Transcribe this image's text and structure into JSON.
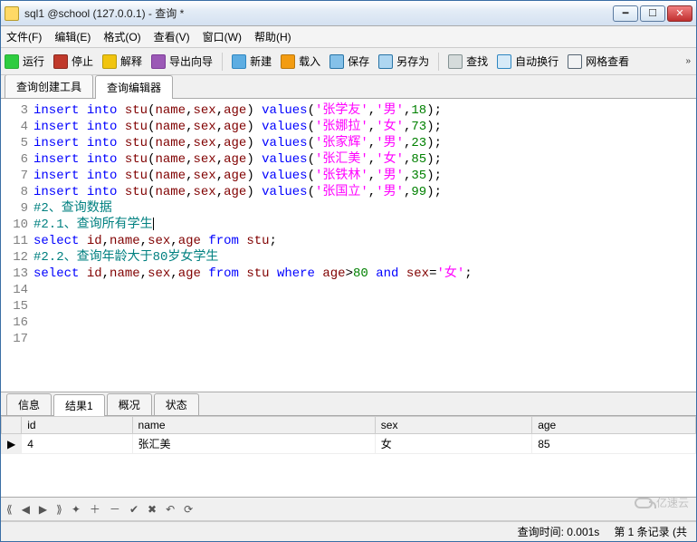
{
  "window": {
    "title": "sql1 @school (127.0.0.1) - 查询 *"
  },
  "menus": [
    "文件(F)",
    "编辑(E)",
    "格式(O)",
    "查看(V)",
    "窗口(W)",
    "帮助(H)"
  ],
  "toolbar": {
    "run": "运行",
    "stop": "停止",
    "explain": "解释",
    "export": "导出向导",
    "new": "新建",
    "load": "载入",
    "save": "保存",
    "saveas": "另存为",
    "find": "查找",
    "wrap": "自动换行",
    "grid": "网格查看"
  },
  "editor_tabs": {
    "builder": "查询创建工具",
    "editor": "查询编辑器"
  },
  "code": {
    "line_start": 3,
    "lines": [
      {
        "n": 3,
        "raw": "insert into stu(name,sex,age) values('张学友','男',18);"
      },
      {
        "n": 4,
        "raw": "insert into stu(name,sex,age) values('张娜拉','女',73);"
      },
      {
        "n": 5,
        "raw": "insert into stu(name,sex,age) values('张家辉','男',23);"
      },
      {
        "n": 6,
        "raw": "insert into stu(name,sex,age) values('张汇美','女',85);"
      },
      {
        "n": 7,
        "raw": "insert into stu(name,sex,age) values('张铁林','男',35);"
      },
      {
        "n": 8,
        "raw": ""
      },
      {
        "n": 9,
        "raw": "insert into stu(name,sex,age) values('张国立','男',99);"
      },
      {
        "n": 10,
        "raw": ""
      },
      {
        "n": 11,
        "raw": "#2、查询数据"
      },
      {
        "n": 12,
        "raw": ""
      },
      {
        "n": 13,
        "raw": "#2.1、查询所有学生"
      },
      {
        "n": 14,
        "raw": "select id,name,sex,age from stu;"
      },
      {
        "n": 15,
        "raw": ""
      },
      {
        "n": 16,
        "raw": "#2.2、查询年龄大于80岁女学生"
      },
      {
        "n": 17,
        "raw": "select id,name,sex,age from stu where age>80 and sex='女';"
      }
    ]
  },
  "result_tabs": {
    "info": "信息",
    "result1": "结果1",
    "profile": "概况",
    "status": "状态"
  },
  "result": {
    "columns": [
      "id",
      "name",
      "sex",
      "age"
    ],
    "rows": [
      {
        "id": 4,
        "name": "张汇美",
        "sex": "女",
        "age": 85
      }
    ]
  },
  "nav_symbols": [
    "⟪",
    "◀",
    "▶",
    "⟫",
    "✦",
    "＋",
    "－",
    "✔",
    "✖",
    "↶",
    "⟳"
  ],
  "status": {
    "time": "查询时间: 0.001s",
    "count": "第 1 条记录 (共"
  },
  "watermark": "亿速云"
}
